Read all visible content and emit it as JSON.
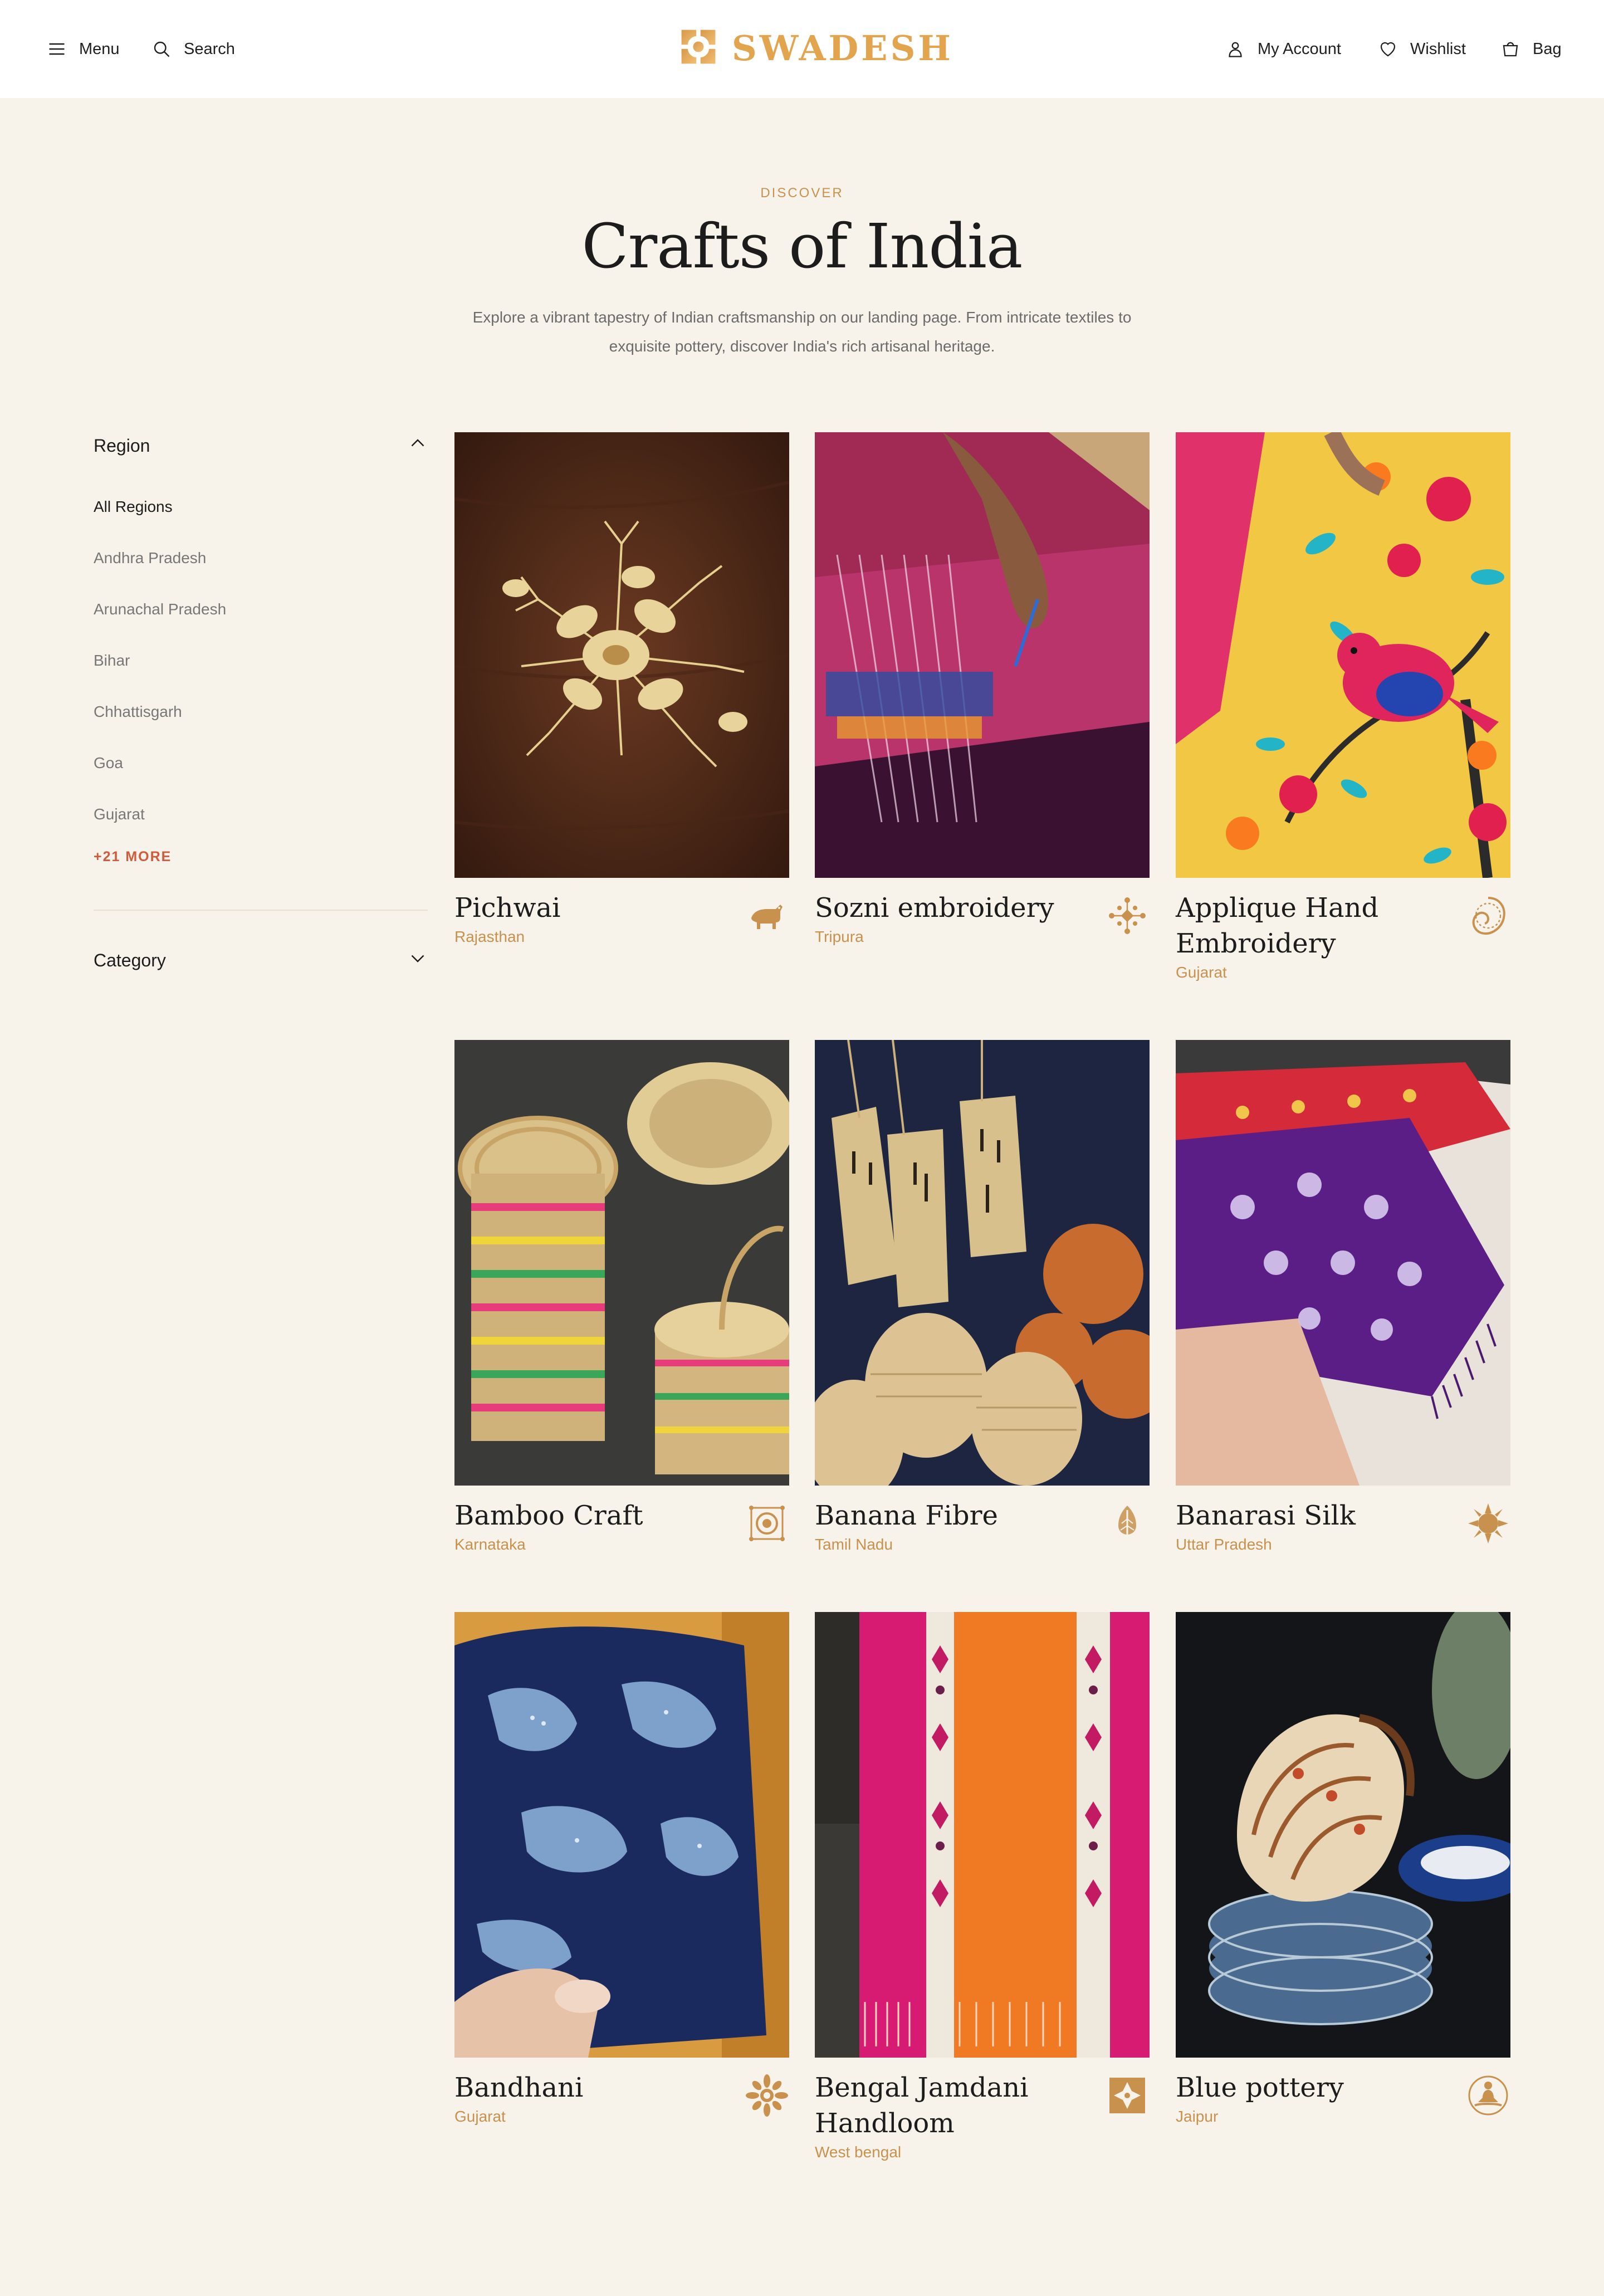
{
  "header": {
    "menu_label": "Menu",
    "search_label": "Search",
    "brand": "SWADESH",
    "account_label": "My Account",
    "wishlist_label": "Wishlist",
    "bag_label": "Bag"
  },
  "hero": {
    "eyebrow": "DISCOVER",
    "title": "Crafts of India",
    "intro": "Explore a vibrant tapestry of Indian craftsmanship on our landing page. From intricate textiles to exquisite pottery, discover India's rich artisanal heritage."
  },
  "filters": {
    "region": {
      "title": "Region",
      "items": [
        "All Regions",
        "Andhra Pradesh",
        "Arunachal Pradesh",
        "Bihar",
        "Chhattisgarh",
        "Goa",
        "Gujarat"
      ],
      "selected": "All Regions",
      "more_label": "+21 MORE"
    },
    "category": {
      "title": "Category"
    }
  },
  "crafts": [
    {
      "name": "Pichwai",
      "region": "Rajasthan",
      "motif": "cow-icon"
    },
    {
      "name": "Sozni embroidery",
      "region": "Tripura",
      "motif": "kolam-icon"
    },
    {
      "name": "Applique Hand Embroidery",
      "region": "Gujarat",
      "motif": "paisley-icon"
    },
    {
      "name": "Bamboo Craft",
      "region": "Karnataka",
      "motif": "medallion-icon"
    },
    {
      "name": "Banana Fibre",
      "region": "Tamil Nadu",
      "motif": "banana-leaf-icon"
    },
    {
      "name": "Banarasi Silk",
      "region": "Uttar Pradesh",
      "motif": "sun-icon"
    },
    {
      "name": "Bandhani",
      "region": "Gujarat",
      "motif": "mandala-icon"
    },
    {
      "name": "Bengal Jamdani Handloom",
      "region": "West bengal",
      "motif": "jamdani-tile-icon"
    },
    {
      "name": "Blue pottery",
      "region": "Jaipur",
      "motif": "meditation-icon"
    }
  ],
  "colors": {
    "accent_gold": "#c8914d",
    "brand_gold": "#e2a44d",
    "more_link": "#cf5a3c",
    "background": "#f7f3ea"
  }
}
